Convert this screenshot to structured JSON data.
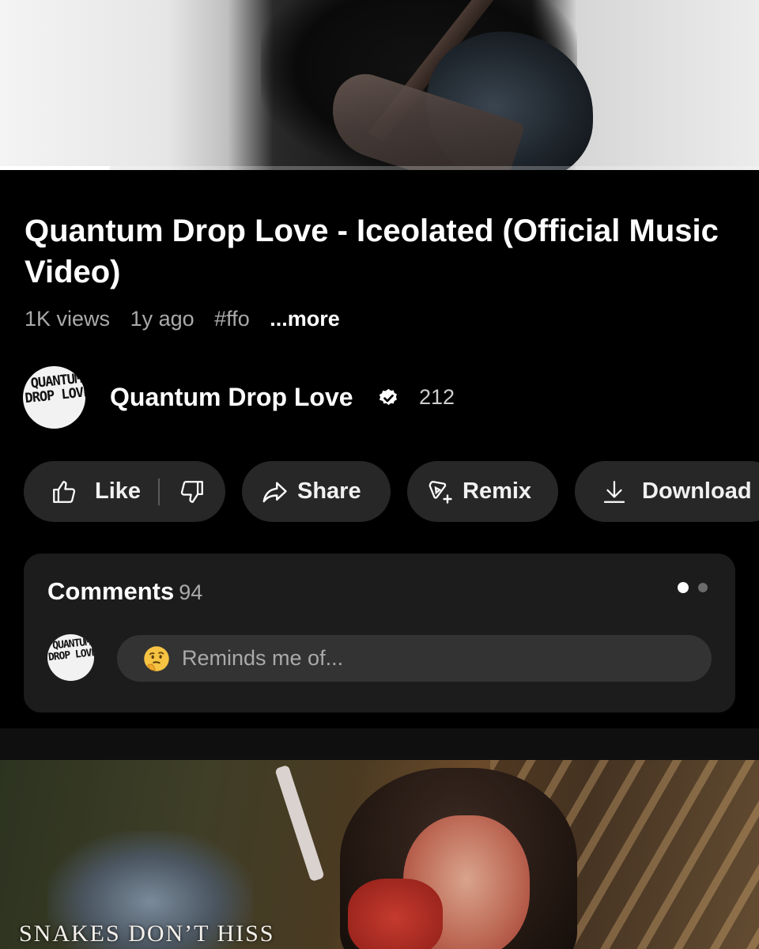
{
  "player": {
    "progress_fraction": 0.145,
    "buffered_fraction": 0.48
  },
  "video": {
    "title": "Quantum Drop Love - Iceolated (Official Music Video)",
    "views": "1K views",
    "age": "1y ago",
    "hashtag": "#ffo",
    "more_label": "...more"
  },
  "channel": {
    "name": "Quantum Drop Love",
    "subscribers": "212",
    "avatar_text": "QUANTUM DROP LOVE",
    "verified_icon": "verified-badge-icon"
  },
  "actions": {
    "like_label": "Like",
    "share_label": "Share",
    "remix_label": "Remix",
    "download_label": "Download"
  },
  "comments": {
    "title": "Comments",
    "count": "94",
    "placeholder_emoji": "thinking-face",
    "placeholder": "Reminds me of..."
  },
  "next_video": {
    "caption": "SNAKES DON’T HISS"
  },
  "colors": {
    "background": "#000000",
    "pill": "#272727",
    "card": "#1c1c1c",
    "input": "#333333",
    "secondary_text": "#aaaaaa"
  }
}
